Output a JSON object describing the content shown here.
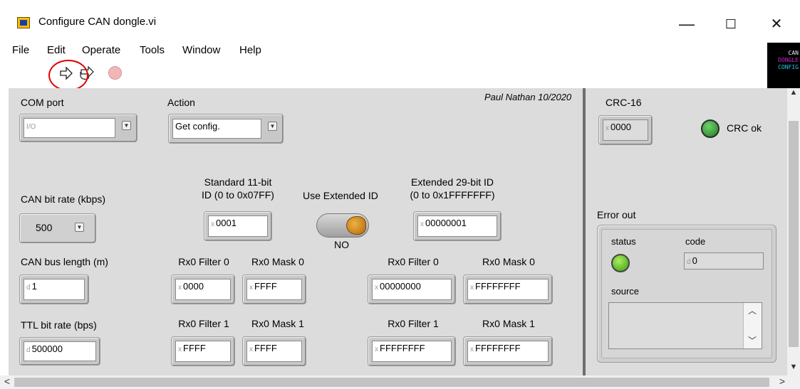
{
  "window": {
    "title": "Configure CAN dongle.vi",
    "minimize": "—",
    "maximize": "☐",
    "close": "✕"
  },
  "menu": [
    "File",
    "Edit",
    "Operate",
    "Tools",
    "Window",
    "Help"
  ],
  "logo": {
    "line1": "CAN",
    "line2": "DONGLE",
    "line3": "CONFIG"
  },
  "toolbar": {
    "run_icon": "run-arrow-icon",
    "run_continuous_icon": "run-continuously-icon",
    "abort_icon": "abort-execution-icon"
  },
  "author": "Paul Nathan 10/2020",
  "com_port": {
    "label": "COM port",
    "radix": "I/O",
    "value": ""
  },
  "action": {
    "label": "Action",
    "value": "Get config."
  },
  "bitrate": {
    "label": "CAN bit rate (kbps)",
    "value": "500"
  },
  "std_id": {
    "label_line1": "Standard 11-bit",
    "label_line2": "ID (0 to 0x07FF)",
    "radix": "x",
    "value": "0001"
  },
  "use_ext": {
    "label": "Use Extended ID",
    "state": "NO"
  },
  "ext_id": {
    "label_line1": "Extended 29-bit ID",
    "label_line2": "(0 to 0x1FFFFFFF)",
    "radix": "x",
    "value": "00000001"
  },
  "bus_length": {
    "label": "CAN bus length (m)",
    "radix": "d",
    "value": "1"
  },
  "ttl_rate": {
    "label": "TTL bit rate (bps)",
    "radix": "d",
    "value": "500000"
  },
  "filters": {
    "std_f0": {
      "label": "Rx0 Filter 0",
      "radix": "x",
      "value": "0000"
    },
    "std_m0": {
      "label": "Rx0 Mask 0",
      "radix": "x",
      "value": "FFFF"
    },
    "std_f1": {
      "label": "Rx0 Filter 1",
      "radix": "x",
      "value": "FFFF"
    },
    "std_m1": {
      "label": "Rx0 Mask 1",
      "radix": "x",
      "value": "FFFF"
    },
    "ext_f0": {
      "label": "Rx0 Filter 0",
      "radix": "x",
      "value": "00000000"
    },
    "ext_m0": {
      "label": "Rx0 Mask 0",
      "radix": "x",
      "value": "FFFFFFFF"
    },
    "ext_f1": {
      "label": "Rx0 Filter 1",
      "radix": "x",
      "value": "FFFFFFFF"
    },
    "ext_m1": {
      "label": "Rx0 Mask 1",
      "radix": "x",
      "value": "FFFFFFFF"
    }
  },
  "crc": {
    "label": "CRC-16",
    "radix": "x",
    "value": "0000",
    "ok_label": "CRC ok",
    "ok_color": "#2e8b2e"
  },
  "error_out": {
    "label": "Error out",
    "status_label": "status",
    "code_label": "code",
    "code_radix": "d",
    "code_value": "0",
    "source_label": "source",
    "source_value": "",
    "status_color": "#5cc81e"
  },
  "scroll": {
    "up": "▲",
    "down": "▼",
    "left": "<",
    "right": ">"
  }
}
